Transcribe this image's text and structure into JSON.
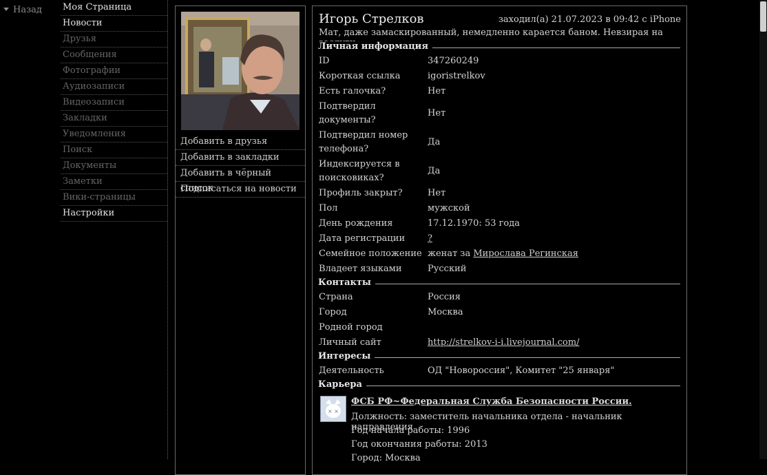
{
  "back": "Назад",
  "menu": [
    {
      "label": "Моя Страница",
      "active": true
    },
    {
      "label": "Новости",
      "active": true
    },
    {
      "label": "Друзья",
      "active": false
    },
    {
      "label": "Сообщения",
      "active": false
    },
    {
      "label": "Фотографии",
      "active": false
    },
    {
      "label": "Аудиозаписи",
      "active": false
    },
    {
      "label": "Видеозаписи",
      "active": false
    },
    {
      "label": "Закладки",
      "active": false
    },
    {
      "label": "Уведомления",
      "active": false
    },
    {
      "label": "Поиск",
      "active": false
    },
    {
      "label": "Документы",
      "active": false
    },
    {
      "label": "Заметки",
      "active": false
    },
    {
      "label": "Вики-страницы",
      "active": false
    },
    {
      "label": "Настройки",
      "active": true
    }
  ],
  "actions": [
    "Добавить в друзья",
    "Добавить в закладки",
    "Добавить в чёрный список",
    "Подписаться на новости"
  ],
  "profile": {
    "name": "Игорь Стрелков",
    "last_seen": "заходил(а) 21.07.2023 в 09:42 с iPhone",
    "status": "Мат, даже замаскированный, немедленно карается баном. Невзирая на заслуги."
  },
  "sections": {
    "personal": "Личная информация",
    "contacts": "Контакты",
    "interests": "Интересы",
    "career": "Карьера"
  },
  "personal": [
    {
      "k": "ID",
      "v": "347260249"
    },
    {
      "k": "Короткая ссылка",
      "v": "igoristrelkov"
    },
    {
      "k": "Есть галочка?",
      "v": "Нет"
    },
    {
      "k1": "Подтвердил",
      "k2": "документы?",
      "v": "Нет"
    },
    {
      "k1": "Подтвердил номер",
      "k2": "телефона?",
      "v": "Да"
    },
    {
      "k1": "Индексируется в",
      "k2": "поисковиках?",
      "v": "Да"
    },
    {
      "k": "Профиль закрыт?",
      "v": "Нет"
    },
    {
      "k": "Пол",
      "v": "мужской"
    },
    {
      "k": "День рождения",
      "v": "17.12.1970: 53 года"
    },
    {
      "k": "Дата регистрации",
      "v": "?"
    },
    {
      "k": "Семейное положение",
      "v_prefix": "женат за",
      "v_link": "Мирослава Регинская"
    },
    {
      "k": "Владеет языками",
      "v": "Русский"
    }
  ],
  "contacts": [
    {
      "k": "Страна",
      "v": "Россия"
    },
    {
      "k": "Город",
      "v": "Москва"
    },
    {
      "k": "Родной город",
      "v": ""
    },
    {
      "k": "Личный сайт",
      "v": "http://strelkov-i-i.livejournal.com/"
    }
  ],
  "interests": [
    {
      "k": "Деятельность",
      "v": "ОД \"Новороссия\", Комитет \"25 января\""
    }
  ],
  "career": {
    "org": "ФСБ РФ~Федеральная Служба Безопасности России.",
    "position": "Должность: заместитель начальника отдела - начальник направления",
    "start": "Год начала работы: 1996",
    "end": "Год окончания работы: 2013",
    "city": "Город: Москва"
  }
}
